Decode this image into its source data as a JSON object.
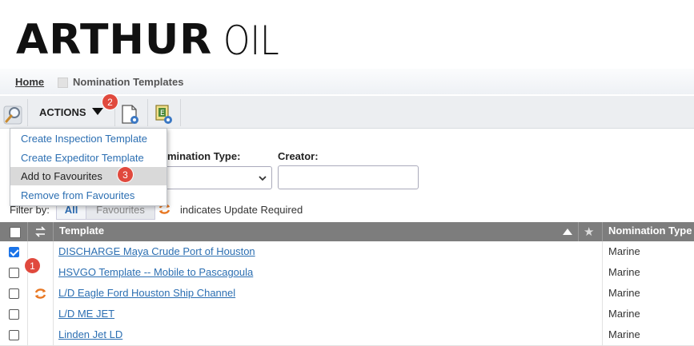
{
  "brand": {
    "name_bold": "ARTHUR",
    "name_light": "OIL"
  },
  "breadcrumb": {
    "home": "Home",
    "current": "Nomination Templates"
  },
  "toolbar": {
    "actions_label": "ACTIONS"
  },
  "badges": [
    "1",
    "2",
    "3"
  ],
  "actions_menu": {
    "items": [
      {
        "label": "Create Inspection Template"
      },
      {
        "label": "Create Expeditor Template"
      },
      {
        "label": "Add to Favourites"
      },
      {
        "label": "Remove from Favourites"
      }
    ]
  },
  "filters": {
    "nomination_type_label": "omination Type:",
    "creator_label": "Creator:",
    "nomination_type_value": "",
    "creator_value": ""
  },
  "filter_bar": {
    "label": "Filter by:",
    "all": "All",
    "favourites": "Favourites",
    "update_text": "indicates Update Required"
  },
  "table": {
    "columns": {
      "template": "Template",
      "nomination_type": "Nomination Type"
    },
    "rows": [
      {
        "template": "DISCHARGE Maya Crude Port of Houston",
        "nomination_type": "Marine",
        "checked": true,
        "update_required": false
      },
      {
        "template": "HSVGO Template -- Mobile to Pascagoula",
        "nomination_type": "Marine",
        "checked": false,
        "update_required": false
      },
      {
        "template": "L/D Eagle Ford Houston Ship Channel",
        "nomination_type": "Marine",
        "checked": false,
        "update_required": true
      },
      {
        "template": "L/D ME JET",
        "nomination_type": "Marine",
        "checked": false,
        "update_required": false
      },
      {
        "template": "Linden Jet LD",
        "nomination_type": "Marine",
        "checked": false,
        "update_required": false
      }
    ]
  },
  "colors": {
    "link": "#2c6fb2",
    "header_bg": "#7d7d7d",
    "badge": "#e0493d",
    "update_icon": "#e87722"
  }
}
